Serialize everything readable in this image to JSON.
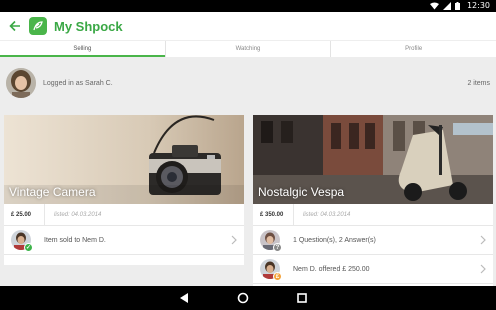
{
  "status_bar": {
    "time": "12:30",
    "icons": [
      "wifi-icon",
      "signal-icon",
      "battery-icon"
    ]
  },
  "app_bar": {
    "title": "My Shpock",
    "back_icon": "arrow-left-icon",
    "logo_icon": "shpock-logo-icon"
  },
  "tabs": [
    {
      "label": "Selling",
      "active": true
    },
    {
      "label": "Watching",
      "active": false
    },
    {
      "label": "Profile",
      "active": false
    }
  ],
  "user": {
    "logged_in_text": "Logged in as Sarah C.",
    "item_count": "2 items"
  },
  "items": [
    {
      "title": "Vintage Camera",
      "price": "£ 25.00",
      "listed": "listed: 04.03.2014",
      "activities": [
        {
          "text": "Item sold to Nem D.",
          "badge": "check-icon"
        }
      ]
    },
    {
      "title": "Nostalgic Vespa",
      "price": "£ 350.00",
      "listed": "listed: 04.03.2014",
      "activities": [
        {
          "text": "1 Question(s), 2 Answer(s)",
          "badge": "question-icon"
        },
        {
          "text": "Nem D. offered £ 250.00",
          "badge": "offer-icon"
        }
      ]
    }
  ],
  "nav_bar": {
    "icons": [
      "back-triangle-icon",
      "home-circle-icon",
      "recents-square-icon"
    ]
  },
  "colors": {
    "accent": "#4ab54a",
    "sold_badge": "#3db34a",
    "offer_badge": "#f3a23a",
    "question_badge": "#888888"
  }
}
